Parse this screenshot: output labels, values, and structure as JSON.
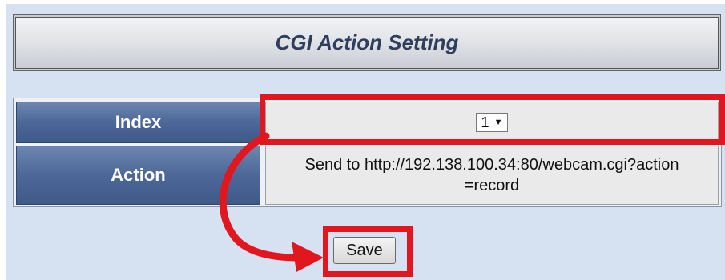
{
  "header": {
    "title": "CGI Action Setting"
  },
  "form": {
    "index_label": "Index",
    "index_value": "1",
    "action_label": "Action",
    "action_value_line1": "Send to http://192.138.100.34:80/webcam.cgi?action",
    "action_value_line2": "=record"
  },
  "buttons": {
    "save_label": "Save"
  },
  "icons": {
    "dropdown": "chevron-down-icon"
  },
  "colors": {
    "background": "#d6e1f2",
    "label_cell": "#4d6898",
    "highlight": "#e1161f"
  }
}
